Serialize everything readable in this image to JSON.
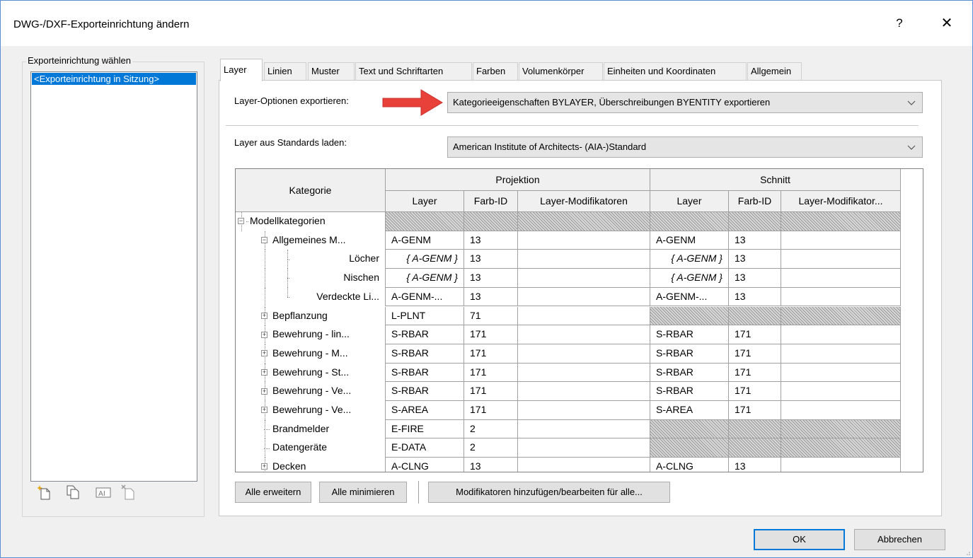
{
  "window": {
    "title": "DWG-/DXF-Exporteinrichtung ändern",
    "help_glyph": "?",
    "close_glyph": "✕"
  },
  "setup_group": {
    "label": "Exporteinrichtung wählen",
    "items": [
      "<Exporteinrichtung in Sitzung>"
    ],
    "tools": [
      "new-setup-icon",
      "duplicate-setup-icon",
      "rename-setup-icon",
      "delete-setup-icon"
    ]
  },
  "tabs": [
    {
      "label": "Layer",
      "active": true
    },
    {
      "label": "Linien"
    },
    {
      "label": "Muster"
    },
    {
      "label": "Text und Schriftarten"
    },
    {
      "label": "Farben"
    },
    {
      "label": "Volumenkörper"
    },
    {
      "label": "Einheiten und Koordinaten"
    },
    {
      "label": "Allgemein"
    }
  ],
  "layer_options": {
    "label": "Layer-Optionen exportieren:",
    "value": "Kategorieeigenschaften BYLAYER, Überschreibungen  BYENTITY exportieren"
  },
  "standards": {
    "label": "Layer aus Standards laden:",
    "value": "American Institute of Architects- (AIA-)Standard"
  },
  "grid": {
    "col_kategorie": "Kategorie",
    "group_projektion": "Projektion",
    "group_schnitt": "Schnitt",
    "col_layer": "Layer",
    "col_farbid": "Farb-ID",
    "col_mod_proj": "Layer-Modifikatoren",
    "col_mod_cut": "Layer-Modifikator...",
    "rows": [
      {
        "name": "Modellkategorien",
        "p_layer": "",
        "p_color": "",
        "c_layer": "",
        "c_color": ""
      },
      {
        "name": "Allgemeines M...",
        "p_layer": "A-GENM",
        "p_color": "13",
        "c_layer": "A-GENM",
        "c_color": "13"
      },
      {
        "name": "Löcher",
        "p_layer": "{ A-GENM }",
        "p_color": "13",
        "c_layer": "{ A-GENM }",
        "c_color": "13"
      },
      {
        "name": "Nischen",
        "p_layer": "{ A-GENM }",
        "p_color": "13",
        "c_layer": "{ A-GENM }",
        "c_color": "13"
      },
      {
        "name": "Verdeckte Li...",
        "p_layer": "A-GENM-...",
        "p_color": "13",
        "c_layer": "A-GENM-...",
        "c_color": "13"
      },
      {
        "name": "Bepflanzung",
        "p_layer": "L-PLNT",
        "p_color": "71",
        "c_layer": "",
        "c_color": ""
      },
      {
        "name": "Bewehrung - lin...",
        "p_layer": "S-RBAR",
        "p_color": "171",
        "c_layer": "S-RBAR",
        "c_color": "171"
      },
      {
        "name": "Bewehrung - M...",
        "p_layer": "S-RBAR",
        "p_color": "171",
        "c_layer": "S-RBAR",
        "c_color": "171"
      },
      {
        "name": "Bewehrung - St...",
        "p_layer": "S-RBAR",
        "p_color": "171",
        "c_layer": "S-RBAR",
        "c_color": "171"
      },
      {
        "name": "Bewehrung - Ve...",
        "p_layer": "S-RBAR",
        "p_color": "171",
        "c_layer": "S-RBAR",
        "c_color": "171"
      },
      {
        "name": "Bewehrung - Ve...",
        "p_layer": "S-AREA",
        "p_color": "171",
        "c_layer": "S-AREA",
        "c_color": "171"
      },
      {
        "name": "Brandmelder",
        "p_layer": "E-FIRE",
        "p_color": "2",
        "c_layer": "",
        "c_color": ""
      },
      {
        "name": "Datengeräte",
        "p_layer": "E-DATA",
        "p_color": "2",
        "c_layer": "",
        "c_color": ""
      },
      {
        "name": "Decken",
        "p_layer": "A-CLNG",
        "p_color": "13",
        "c_layer": "A-CLNG",
        "c_color": "13"
      }
    ]
  },
  "buttons": {
    "expand_all": "Alle erweitern",
    "collapse_all": "Alle minimieren",
    "modifiers": "Modifikatoren hinzufügen/bearbeiten für alle...",
    "ok": "OK",
    "cancel": "Abbrechen"
  }
}
